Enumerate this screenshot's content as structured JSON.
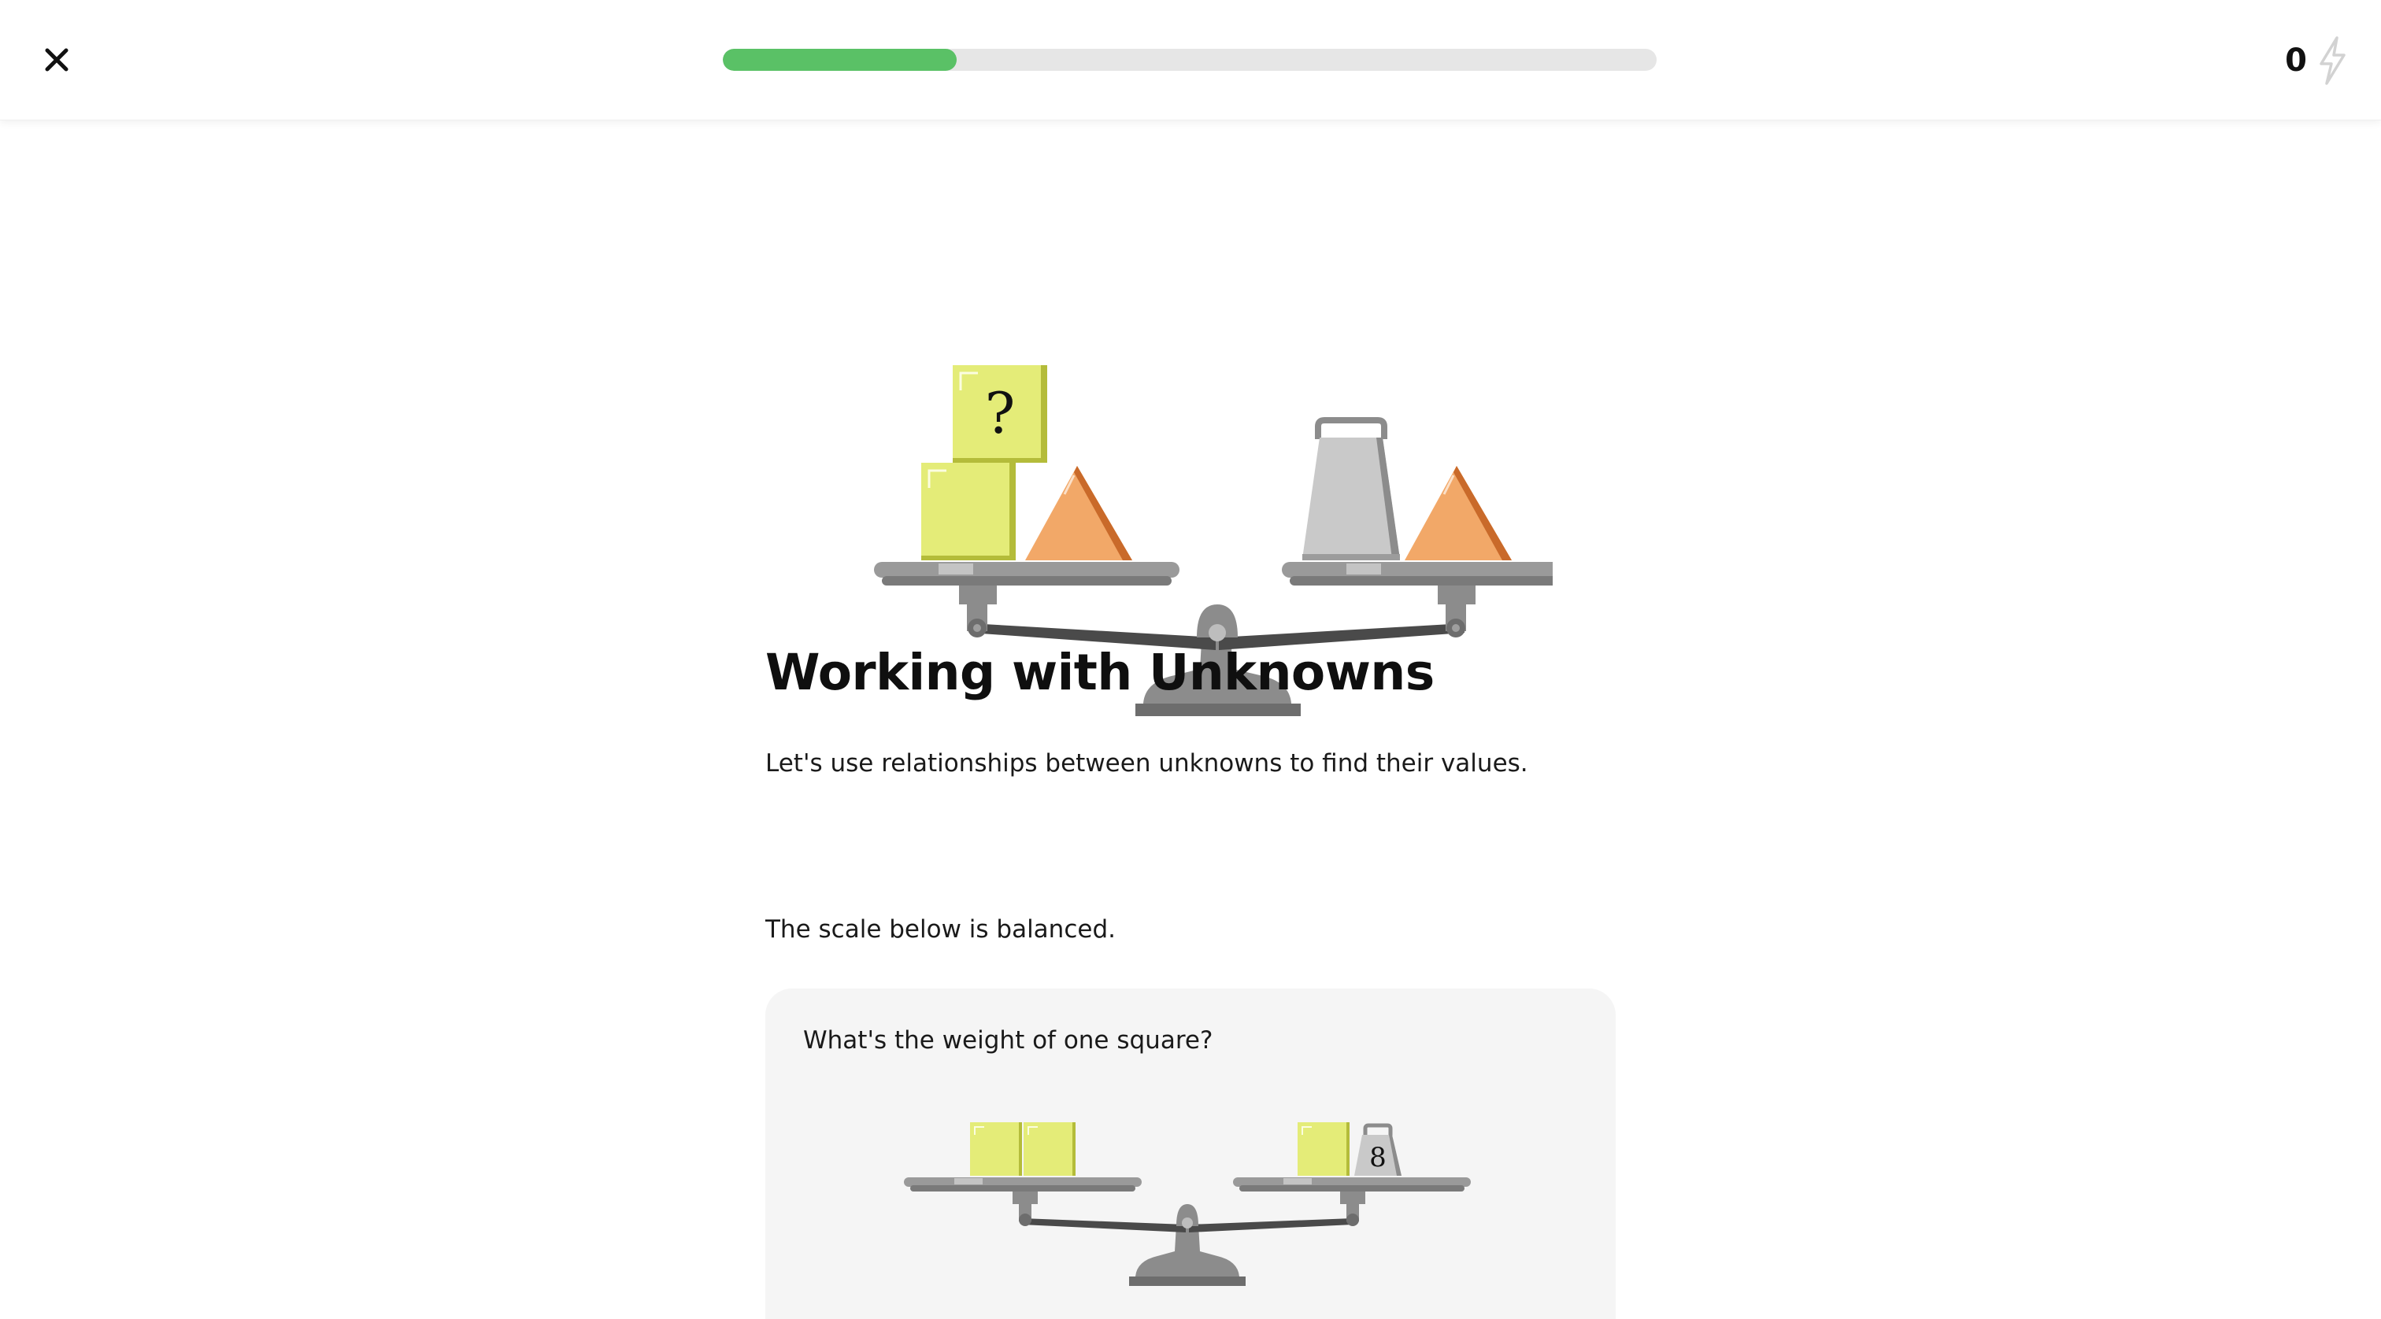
{
  "header": {
    "close_icon": "close-icon",
    "progress": {
      "value_percent": 25,
      "color": "#5ac166",
      "track_color": "#e6e6e6"
    },
    "energy": {
      "count": "0",
      "icon": "lightning-icon"
    }
  },
  "lesson": {
    "hero_scale": {
      "left_pan": [
        "square",
        "square-with-question-mark",
        "triangle"
      ],
      "right_pan": [
        "weight",
        "triangle"
      ],
      "unknown_label": "?"
    },
    "title": "Working with Unknowns",
    "intro": "Let's use relationships between unknowns to find their values.",
    "prompt": "The scale below is balanced.",
    "question": {
      "text": "What's the weight of one square?",
      "scale": {
        "left_pan": [
          "square",
          "square"
        ],
        "right_pan": [
          "square",
          "weight"
        ],
        "weight_label": "8"
      }
    }
  },
  "colors": {
    "square": "#e4ec78",
    "triangle": "#f2a868",
    "weight": "#c9c9c9",
    "scale": "#8a8a8a"
  }
}
